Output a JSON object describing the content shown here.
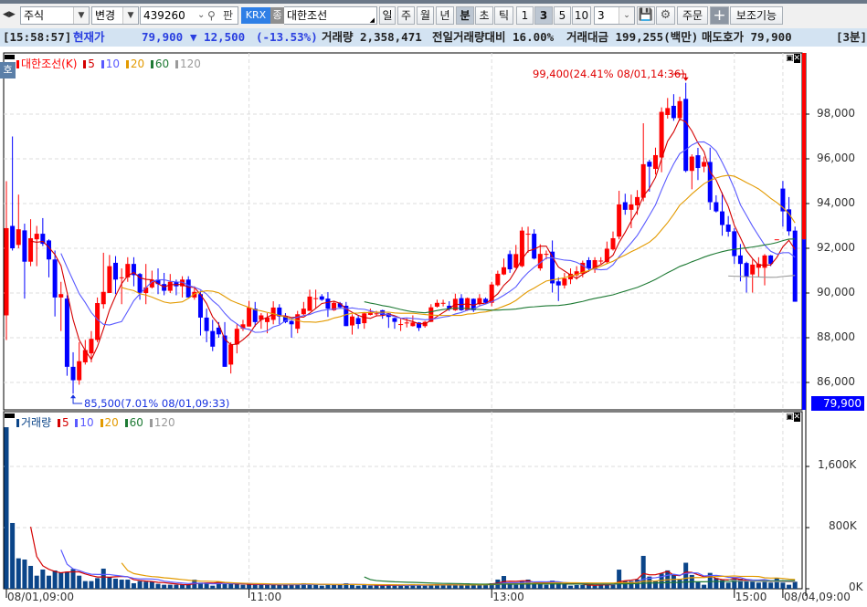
{
  "toolbar": {
    "market_select": "주식",
    "change_select": "변경",
    "code_input": "439260",
    "pan_label": "판",
    "exchange_badge": "KRX",
    "jong_badge": "종",
    "stock_name": "대한조선",
    "period_buttons": [
      "일",
      "주",
      "월",
      "년",
      "분",
      "초",
      "틱"
    ],
    "active_period": "분",
    "interval_buttons": [
      "1",
      "3",
      "5",
      "10"
    ],
    "active_interval": "3",
    "interval_select": "3",
    "order_button": "주문",
    "plus_button": "+",
    "aux_button": "보조기능"
  },
  "infobar": {
    "time": "[15:58:57]",
    "price_label": "현재가",
    "price": "79,900",
    "change": "▼ 12,500",
    "change_pct": "(-13.53%)",
    "volume": "거래량 2,358,471",
    "vol_ratio": "전일거래량대비 16.00%",
    "turnover": "거래대금 199,255(백만)",
    "ask": "매도호가 79,900",
    "period": "[3분]"
  },
  "side_tab": "호",
  "colors": {
    "up": "#ff0000",
    "down": "#0000ff",
    "ma5": "#d40000",
    "ma10": "#5a5aff",
    "ma20": "#e39a00",
    "ma60": "#1e7a34",
    "ma120": "#9a9a9a",
    "volume": "#0b4589"
  },
  "price_legend": {
    "name": "대한조선(K)",
    "ma": [
      "5",
      "10",
      "20",
      "60",
      "120"
    ]
  },
  "volume_legend": {
    "name": "거래량",
    "ma": [
      "5",
      "10",
      "20",
      "60",
      "120"
    ]
  },
  "chart_data": {
    "type": "candlestick",
    "title": "대한조선(K) 3분",
    "current_price_label": "79,900",
    "prev_close": 92400,
    "high_annotation": "99,400(24.41% 08/01,14:36)",
    "low_annotation": "85,500(7.01% 08/01,09:33)",
    "high_index": 112,
    "high_value": 99400,
    "low_index": 11,
    "low_value": 85500,
    "price_ticks": [
      {
        "v": 98000,
        "label": "98,000"
      },
      {
        "v": 96000,
        "label": "96,000"
      },
      {
        "v": 94000,
        "label": "94,000"
      },
      {
        "v": 92000,
        "label": "92,000"
      },
      {
        "v": 90000,
        "label": "90,000"
      },
      {
        "v": 88000,
        "label": "88,000"
      },
      {
        "v": 86000,
        "label": "86,000"
      }
    ],
    "volume_ticks": [
      {
        "v": 1600,
        "label": "1,600K"
      },
      {
        "v": 800,
        "label": "800K"
      },
      {
        "v": 0,
        "label": "0K"
      }
    ],
    "time_ticks": [
      {
        "i": 0,
        "label": "08/01,09:00"
      },
      {
        "i": 40,
        "label": "11:00"
      },
      {
        "i": 80,
        "label": "13:00"
      },
      {
        "i": 120,
        "label": "15:00"
      },
      {
        "i": 128,
        "label": "08/04,09:00"
      }
    ],
    "ma_periods": [
      5,
      10,
      20,
      60,
      120
    ],
    "candles_ohlc": [
      [
        89000,
        95000,
        87900,
        92900
      ],
      [
        93000,
        97000,
        91900,
        92000
      ],
      [
        92150,
        94400,
        92000,
        92850
      ],
      [
        92800,
        93100,
        89750,
        91400
      ],
      [
        91400,
        93300,
        91200,
        92450
      ],
      [
        92400,
        93000,
        91200,
        92650
      ],
      [
        92650,
        93350,
        92100,
        92200
      ],
      [
        92350,
        92400,
        90700,
        91500
      ],
      [
        91500,
        91900,
        88950,
        89800
      ],
      [
        89800,
        90500,
        88300,
        89950
      ],
      [
        89750,
        89900,
        86300,
        86700
      ],
      [
        86700,
        87350,
        85500,
        86100
      ],
      [
        86100,
        87800,
        85900,
        86950
      ],
      [
        86900,
        87900,
        86800,
        87450
      ],
      [
        87300,
        88300,
        86900,
        87950
      ],
      [
        87900,
        89800,
        87800,
        89550
      ],
      [
        89500,
        91800,
        89300,
        90050
      ],
      [
        90000,
        91700,
        90000,
        91200
      ],
      [
        91350,
        91650,
        89950,
        90600
      ],
      [
        90700,
        91100,
        89500,
        90700
      ],
      [
        90700,
        91600,
        90500,
        91300
      ],
      [
        91300,
        91600,
        90300,
        90800
      ],
      [
        90850,
        90900,
        89700,
        90000
      ],
      [
        90000,
        91300,
        89500,
        90250
      ],
      [
        90250,
        91000,
        90200,
        90600
      ],
      [
        90600,
        91100,
        89950,
        90400
      ],
      [
        90400,
        90900,
        89900,
        90100
      ],
      [
        90100,
        90850,
        90000,
        90500
      ],
      [
        90500,
        90600,
        89900,
        90300
      ],
      [
        90300,
        90750,
        89800,
        90600
      ],
      [
        90600,
        90750,
        89800,
        89800
      ],
      [
        89800,
        90300,
        89700,
        90050
      ],
      [
        89950,
        90100,
        88100,
        88900
      ],
      [
        88900,
        89300,
        87800,
        88300
      ],
      [
        88300,
        88800,
        87400,
        87600
      ],
      [
        88450,
        88700,
        88000,
        88150
      ],
      [
        88100,
        88700,
        86700,
        86700
      ],
      [
        86800,
        87800,
        86400,
        87700
      ],
      [
        87700,
        88600,
        87300,
        88400
      ],
      [
        88400,
        88800,
        88300,
        88600
      ],
      [
        88500,
        89650,
        88500,
        89350
      ],
      [
        89300,
        89600,
        88500,
        88700
      ],
      [
        88800,
        89100,
        88400,
        89000
      ],
      [
        88700,
        89100,
        88200,
        88900
      ],
      [
        88800,
        89630,
        88600,
        89350
      ],
      [
        89350,
        89500,
        88600,
        88950
      ],
      [
        88950,
        89100,
        88650,
        88700
      ],
      [
        88750,
        88800,
        88000,
        88600
      ],
      [
        88400,
        89200,
        88200,
        89050
      ],
      [
        89050,
        89600,
        89000,
        89300
      ],
      [
        89200,
        90150,
        89200,
        89840
      ],
      [
        89770,
        90150,
        89300,
        89770
      ],
      [
        89850,
        89950,
        89650,
        89700
      ],
      [
        89750,
        90040,
        88930,
        89300
      ],
      [
        89230,
        89650,
        89200,
        89560
      ],
      [
        89540,
        89600,
        89300,
        89360
      ],
      [
        89430,
        89600,
        88520,
        88520
      ],
      [
        88550,
        89050,
        88140,
        88950
      ],
      [
        88880,
        89020,
        88400,
        88610
      ],
      [
        88650,
        89100,
        88400,
        89090
      ],
      [
        89020,
        89300,
        89000,
        89160
      ],
      [
        89090,
        89200,
        88950,
        89090
      ],
      [
        89230,
        89250,
        88850,
        89020
      ],
      [
        89090,
        89100,
        88440,
        88930
      ],
      [
        88880,
        88900,
        88400,
        88710
      ],
      [
        88610,
        88850,
        88300,
        88610
      ],
      [
        88680,
        88900,
        88460,
        88680
      ],
      [
        88520,
        89000,
        88500,
        88680
      ],
      [
        88680,
        88700,
        88300,
        88440
      ],
      [
        88520,
        88750,
        88450,
        88710
      ],
      [
        88710,
        89500,
        88700,
        89360
      ],
      [
        89390,
        89700,
        89350,
        89560
      ],
      [
        89560,
        89700,
        89400,
        89560
      ],
      [
        89430,
        89630,
        89200,
        89290
      ],
      [
        89230,
        89970,
        89200,
        89740
      ],
      [
        89770,
        89950,
        89200,
        89230
      ],
      [
        89230,
        89800,
        89200,
        89770
      ],
      [
        89740,
        89760,
        89150,
        89230
      ],
      [
        89500,
        89950,
        89450,
        89770
      ],
      [
        89740,
        89800,
        89500,
        89560
      ],
      [
        89560,
        90500,
        89400,
        90380
      ],
      [
        90350,
        91000,
        90300,
        90860
      ],
      [
        90830,
        91540,
        90800,
        91150
      ],
      [
        91740,
        91900,
        90900,
        91060
      ],
      [
        91130,
        92150,
        91100,
        91740
      ],
      [
        91200,
        92950,
        91150,
        92790
      ],
      [
        92650,
        92966,
        91800,
        92650
      ],
      [
        92650,
        92850,
        91500,
        91540
      ],
      [
        91100,
        92180,
        91000,
        91750
      ],
      [
        91750,
        91900,
        91500,
        91750
      ],
      [
        91850,
        92350,
        90020,
        90430
      ],
      [
        90520,
        90700,
        89640,
        90340
      ],
      [
        90340,
        90900,
        90200,
        90650
      ],
      [
        90610,
        91100,
        90400,
        90860
      ],
      [
        90790,
        91200,
        90600,
        90970
      ],
      [
        90860,
        91450,
        90700,
        91350
      ],
      [
        91470,
        91600,
        90950,
        91100
      ],
      [
        91060,
        91600,
        90900,
        91470
      ],
      [
        91450,
        91600,
        91300,
        91450
      ],
      [
        91380,
        92300,
        91300,
        91980
      ],
      [
        91950,
        92750,
        91900,
        92450
      ],
      [
        92520,
        94570,
        92400,
        93960
      ],
      [
        94060,
        94440,
        93500,
        93720
      ],
      [
        93720,
        94400,
        92900,
        93960
      ],
      [
        93920,
        94600,
        93500,
        94290
      ],
      [
        94260,
        97590,
        94100,
        95760
      ],
      [
        95870,
        95960,
        94530,
        95650
      ],
      [
        95550,
        96500,
        95300,
        96165
      ],
      [
        96060,
        98300,
        95400,
        98100
      ],
      [
        97960,
        98720,
        97800,
        98270
      ],
      [
        98370,
        98890,
        97700,
        97820
      ],
      [
        97820,
        98780,
        97700,
        98580
      ],
      [
        98680,
        99400,
        95400,
        95460
      ],
      [
        95460,
        96200,
        94640,
        96100
      ],
      [
        96160,
        96490,
        95050,
        95590
      ],
      [
        95650,
        96100,
        95400,
        95860
      ],
      [
        95860,
        96500,
        93720,
        94060
      ],
      [
        94060,
        94370,
        93600,
        93650
      ],
      [
        93650,
        94500,
        92560,
        93040
      ],
      [
        93060,
        93440,
        92520,
        92740
      ],
      [
        92760,
        92900,
        91300,
        91650
      ],
      [
        91680,
        92190,
        90520,
        91300
      ],
      [
        91340,
        91400,
        90020,
        90720
      ],
      [
        90830,
        91500,
        90020,
        91270
      ],
      [
        91130,
        91600,
        90700,
        91300
      ],
      [
        91130,
        91740,
        90340,
        91680
      ],
      [
        91680,
        91700,
        91200,
        91300
      ],
      [
        92400,
        92400,
        92400,
        92400
      ],
      [
        94670,
        95010,
        92970,
        93650
      ],
      [
        93740,
        94290,
        92560,
        92760
      ],
      [
        92790,
        92970,
        89610,
        89610
      ]
    ],
    "volumes_k": [
      2113,
      860,
      398,
      382,
      299,
      171,
      251,
      171,
      239,
      211,
      223,
      259,
      171,
      100,
      100,
      139,
      263,
      151,
      131,
      119,
      119,
      72,
      100,
      92,
      92,
      64,
      52,
      52,
      52,
      52,
      52,
      119,
      80,
      80,
      40,
      92,
      60,
      60,
      60,
      52,
      60,
      52,
      52,
      52,
      52,
      52,
      52,
      52,
      60,
      72,
      60,
      52,
      40,
      60,
      52,
      60,
      72,
      48,
      40,
      52,
      40,
      48,
      40,
      52,
      40,
      40,
      48,
      60,
      52,
      40,
      48,
      60,
      52,
      60,
      48,
      52,
      72,
      60,
      52,
      60,
      72,
      120,
      167,
      72,
      52,
      107,
      120,
      80,
      60,
      52,
      107,
      92,
      60,
      40,
      48,
      48,
      48,
      40,
      60,
      60,
      52,
      250,
      100,
      100,
      120,
      430,
      160,
      107,
      200,
      240,
      187,
      120,
      340,
      180,
      88,
      52,
      207,
      140,
      112,
      80,
      140,
      131,
      100,
      100,
      80,
      107,
      80,
      140,
      80,
      52,
      92
    ]
  }
}
